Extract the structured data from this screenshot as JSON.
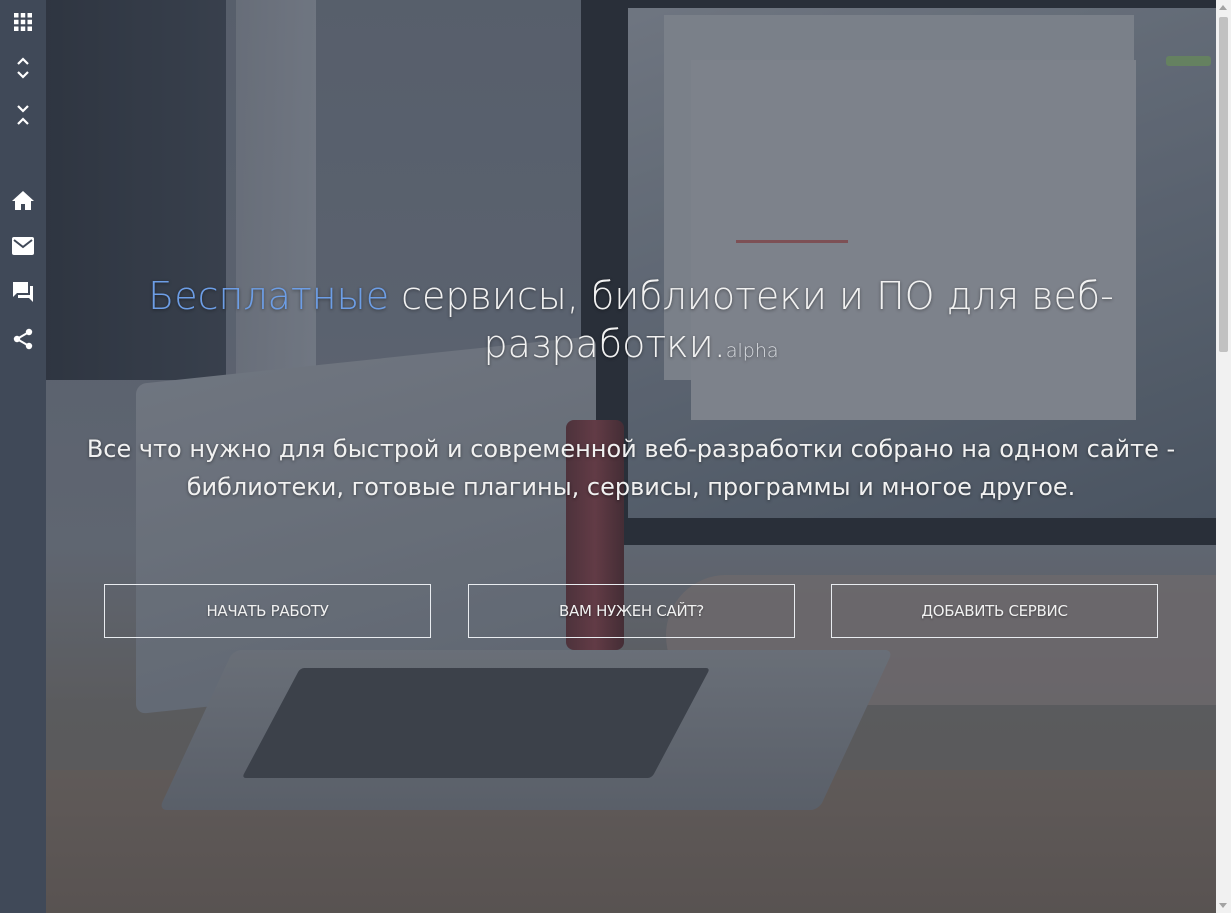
{
  "sidebar": {
    "items": [
      {
        "icon": "apps-grid-icon",
        "label": "Menu"
      },
      {
        "icon": "expand-icon",
        "label": "Expand"
      },
      {
        "icon": "collapse-icon",
        "label": "Collapse"
      },
      {
        "icon": "home-icon",
        "label": "Home"
      },
      {
        "icon": "mail-icon",
        "label": "Mail"
      },
      {
        "icon": "chat-icon",
        "label": "Feedback"
      },
      {
        "icon": "share-icon",
        "label": "Share"
      }
    ],
    "icon_color": "#ffffff",
    "background": "#404958"
  },
  "hero": {
    "title_accent": "Бесплатные",
    "title_rest": " сервисы, библиотеки и ПО для веб-разработки.",
    "title_tag": "alpha",
    "subtitle": "Все что нужно для быстрой и современной веб-разработки собрано на одном сайте - библиотеки, готовые плагины, сервисы, программы и многое другое.",
    "accent_color": "#6d9ee6"
  },
  "actions": {
    "start": "НАЧАТЬ РАБОТУ",
    "need_site": "ВАМ НУЖЕН САЙТ?",
    "add_service": "ДОБАВИТЬ СЕРВИС"
  }
}
